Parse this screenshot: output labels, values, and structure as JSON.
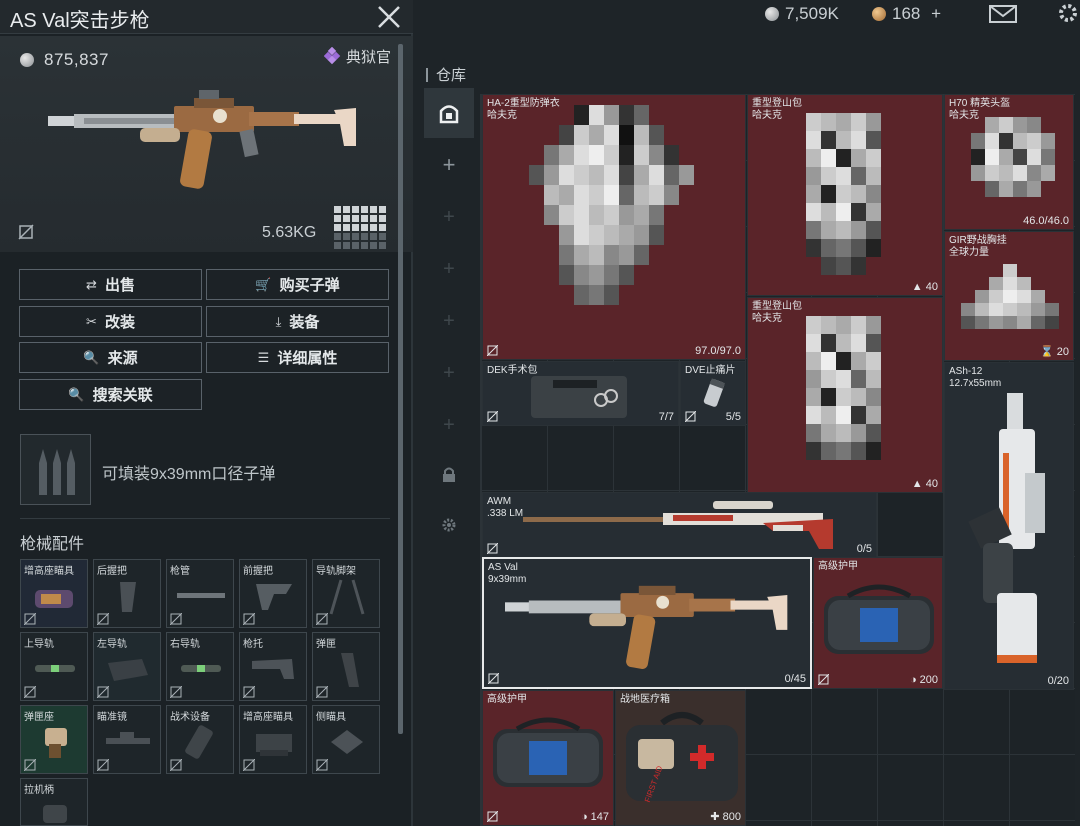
{
  "detail": {
    "title": "AS Val突击步枪",
    "price": "875,837",
    "rarity": "典狱官",
    "weight": "5.63KG",
    "actions": {
      "sell": "出售",
      "buy_ammo": "购买子弹",
      "modify": "改装",
      "equip": "装备",
      "source": "来源",
      "details": "详细属性",
      "search_related": "搜索关联"
    },
    "ammo_info": "可填装9x39mm口径子弹",
    "attachments_title": "枪械配件",
    "attachments": [
      {
        "label": "增高座瞄具"
      },
      {
        "label": "后握把"
      },
      {
        "label": "枪管"
      },
      {
        "label": "前握把"
      },
      {
        "label": "导轨脚架"
      },
      {
        "label": "上导轨"
      },
      {
        "label": "左导轨"
      },
      {
        "label": "右导轨"
      },
      {
        "label": "枪托"
      },
      {
        "label": "弹匣"
      },
      {
        "label": "弹匣座"
      },
      {
        "label": "瞄准镜"
      },
      {
        "label": "战术设备"
      },
      {
        "label": "增高座瞄具"
      },
      {
        "label": "侧瞄具"
      },
      {
        "label": "拉机柄"
      }
    ]
  },
  "topbar": {
    "currency_silver": "7,509K",
    "currency_gold": "168",
    "plus": "+"
  },
  "storage": {
    "title": "仓库",
    "items": [
      {
        "name": "HA-2重型防弹衣",
        "sub": "哈夫克",
        "count": "97.0/97.0"
      },
      {
        "name": "重型登山包",
        "sub": "哈夫克",
        "count": "40"
      },
      {
        "name": "H70 精英头盔",
        "sub": "哈夫克",
        "count": "46.0/46.0"
      },
      {
        "name": "GIR野战胸挂",
        "sub": "全球力量",
        "count": "20"
      },
      {
        "name": "重型登山包",
        "sub": "哈夫克",
        "count": "40"
      },
      {
        "name": "DEK手术包",
        "sub": "",
        "count": "7/7"
      },
      {
        "name": "DVE止痛片",
        "sub": "",
        "count": "5/5"
      },
      {
        "name": "ASh-12",
        "sub": "12.7x55mm",
        "count": "0/20"
      },
      {
        "name": "AWM",
        "sub": ".338 LM",
        "count": "0/5"
      },
      {
        "name": "AS Val",
        "sub": "9x39mm",
        "count": "0/45"
      },
      {
        "name": "高级护甲",
        "sub": "",
        "count": "200"
      },
      {
        "name": "高级护甲",
        "sub": "",
        "count": "147"
      },
      {
        "name": "战地医疗箱",
        "sub": "",
        "count": "800"
      }
    ],
    "medkit_print": "FIRST AID"
  }
}
